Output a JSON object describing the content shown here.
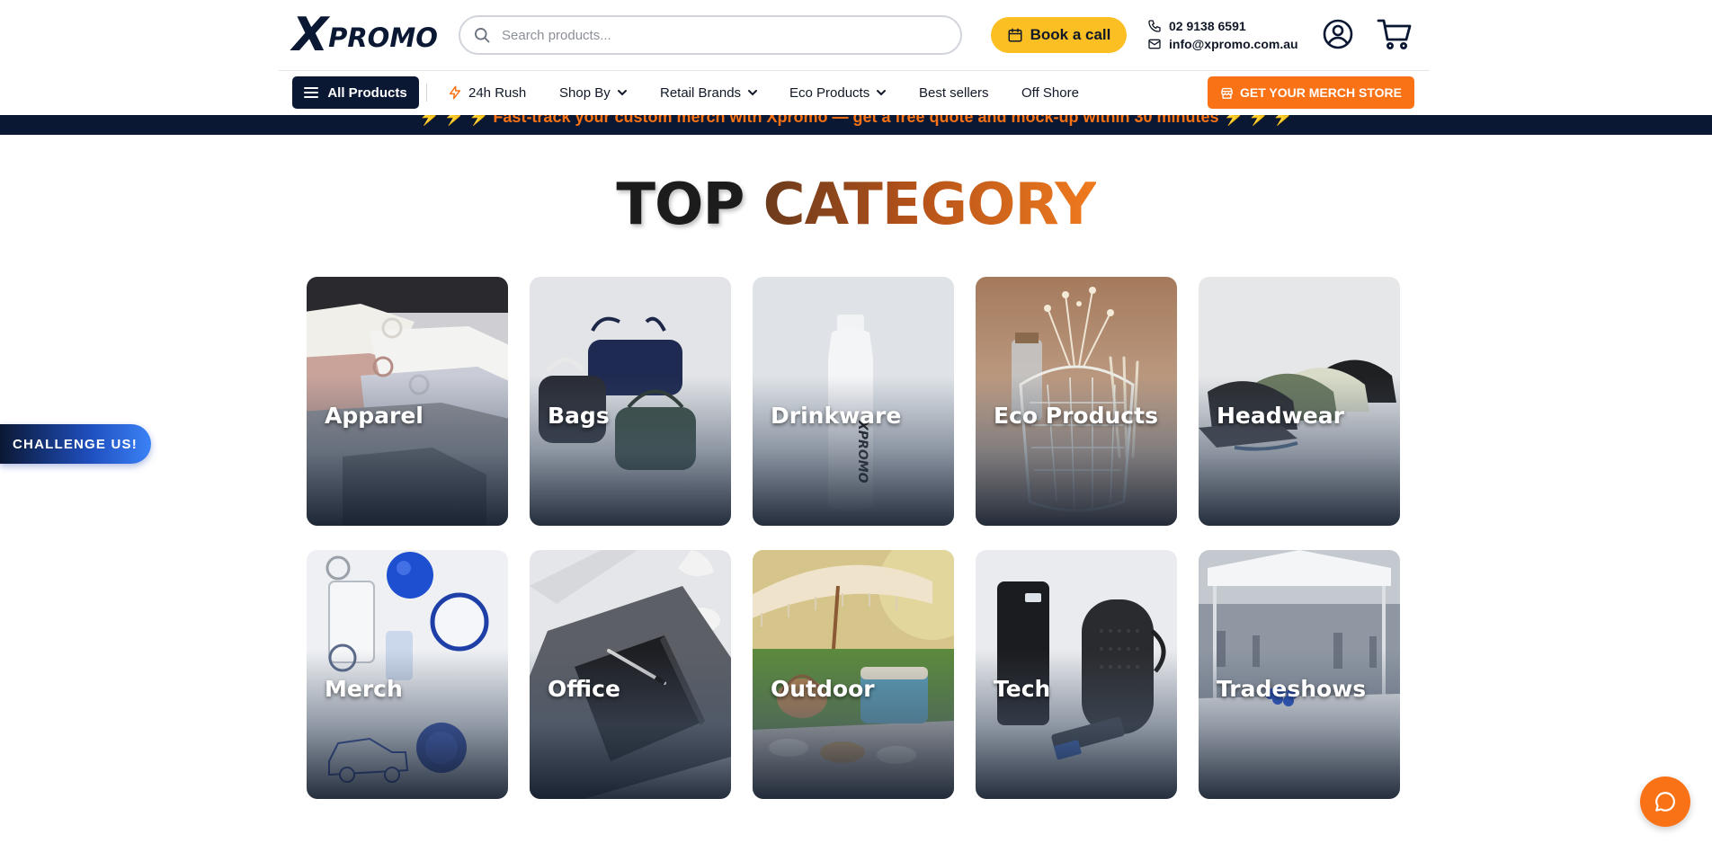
{
  "brand": {
    "logo_x": "X",
    "logo_text": "PROMO"
  },
  "search": {
    "placeholder": "Search products..."
  },
  "header": {
    "book_call_label": "Book a call",
    "phone": "02 9138 6591",
    "email": "info@xpromo.com.au"
  },
  "nav": {
    "all_products": "All Products",
    "items": [
      {
        "label": "24h Rush",
        "icon": "lightning-icon"
      },
      {
        "label": "Shop By",
        "icon": "chevron-down-icon"
      },
      {
        "label": "Retail Brands",
        "icon": "chevron-down-icon"
      },
      {
        "label": "Eco Products",
        "icon": "chevron-down-icon"
      },
      {
        "label": "Best sellers"
      },
      {
        "label": "Off Shore"
      }
    ],
    "merch_store": "GET YOUR MERCH STORE"
  },
  "announcement": "⚡ ⚡ ⚡ Fast-track your custom merch with Xpromo — get a free quote and mock-up within 30 minutes ⚡ ⚡ ⚡",
  "section": {
    "title_part1": "TOP",
    "title_part2": "CATEGORY"
  },
  "categories": [
    {
      "label": "Apparel"
    },
    {
      "label": "Bags"
    },
    {
      "label": "Drinkware"
    },
    {
      "label": "Eco Products"
    },
    {
      "label": "Headwear"
    },
    {
      "label": "Merch"
    },
    {
      "label": "Office"
    },
    {
      "label": "Outdoor"
    },
    {
      "label": "Tech"
    },
    {
      "label": "Tradeshows"
    }
  ],
  "floating": {
    "challenge_label": "CHALLENGE US!"
  },
  "colors": {
    "navy": "#0b1833",
    "accent_orange": "#f97316",
    "book_call_yellow": "#fbbf24"
  }
}
